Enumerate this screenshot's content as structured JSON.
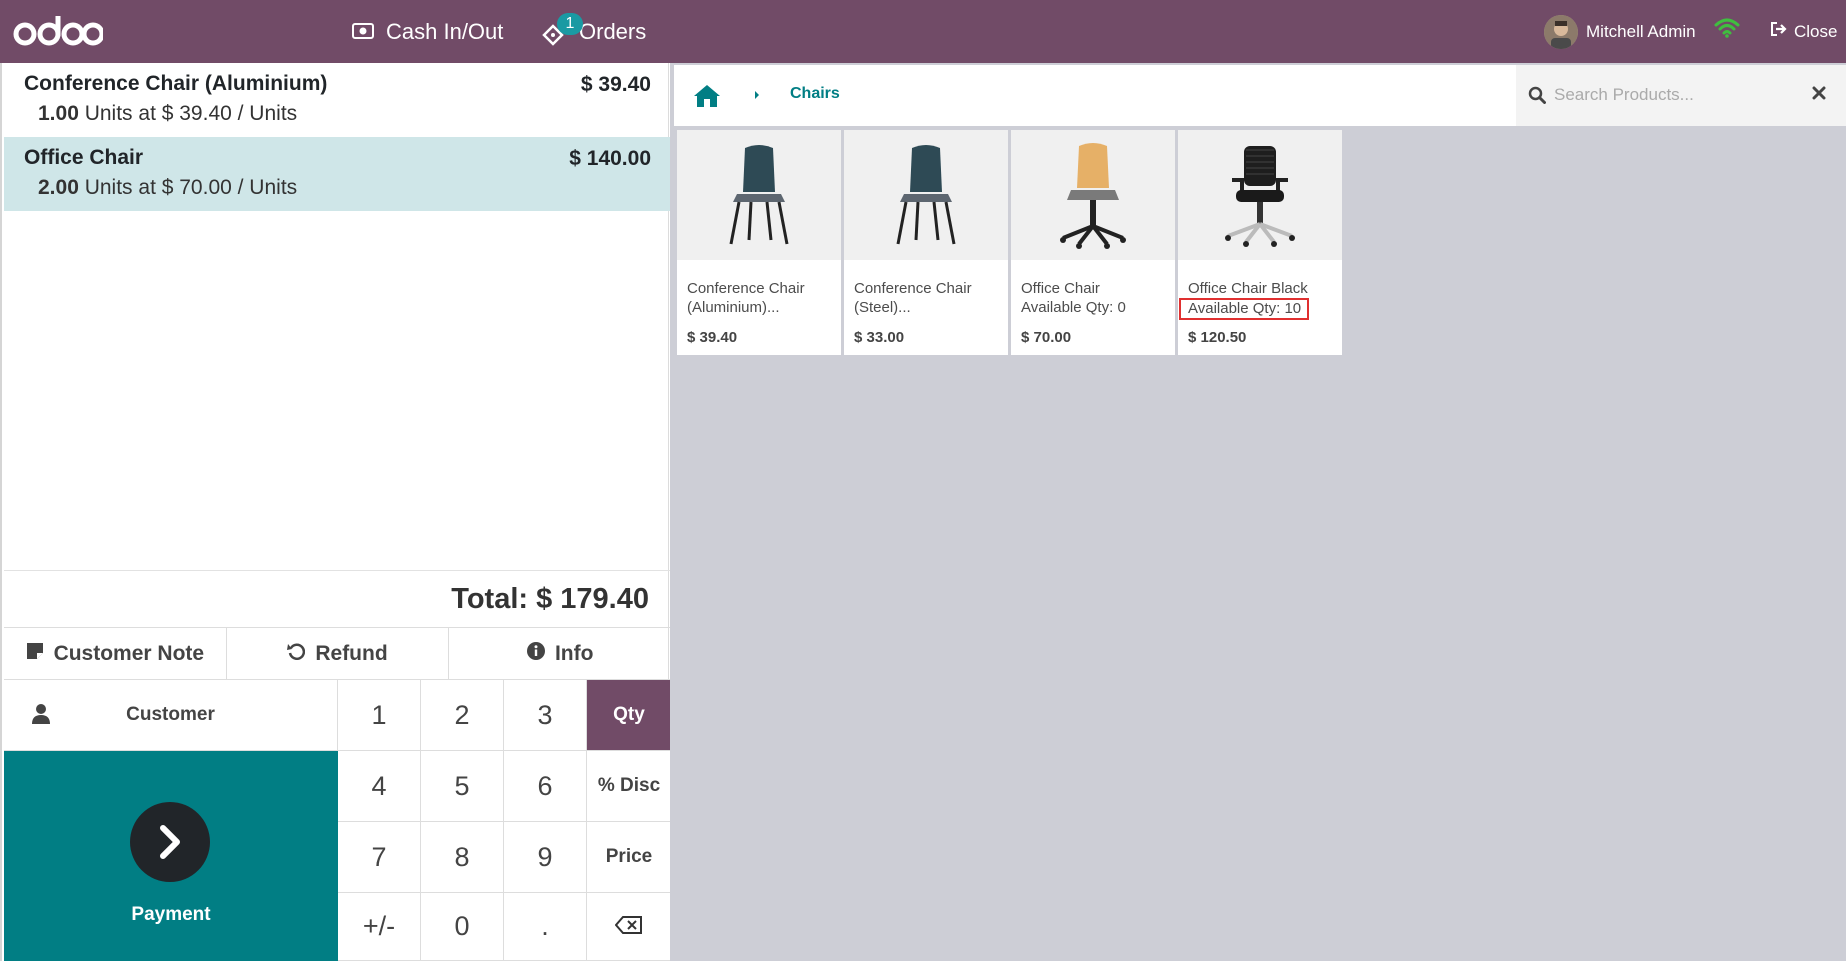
{
  "topbar": {
    "logo_text": "odoo",
    "cash_label": "Cash In/Out",
    "orders_label": "Orders",
    "orders_count": "1",
    "user_name": "Mitchell Admin",
    "close_label": "Close",
    "bg_color": "#714b67"
  },
  "order": {
    "lines": [
      {
        "name": "Conference Chair (Aluminium)",
        "price": "$ 39.40",
        "qty": "1.00",
        "detail": " Units at $ 39.40 / Units",
        "selected": false
      },
      {
        "name": "Office Chair",
        "price": "$ 140.00",
        "qty": "2.00",
        "detail": " Units at $ 70.00 / Units",
        "selected": true
      }
    ],
    "total": "Total: $ 179.40"
  },
  "actions": {
    "customer_note": "Customer Note",
    "refund": "Refund",
    "info": "Info"
  },
  "numpad": {
    "customer": "Customer",
    "payment": "Payment",
    "keys": [
      "1",
      "2",
      "3",
      "Qty",
      "4",
      "5",
      "6",
      "% Disc",
      "7",
      "8",
      "9",
      "Price",
      "+/-",
      "0",
      ".",
      "backspace"
    ],
    "active_mode": "Qty",
    "payment_color": "#017e84"
  },
  "products_panel": {
    "breadcrumb": "Chairs",
    "search_placeholder": "Search Products...",
    "products": [
      {
        "line1": "Conference Chair",
        "line2": "(Aluminium)...",
        "price": "$ 39.40",
        "image": "chair-dark-teal"
      },
      {
        "line1": "Conference Chair",
        "line2": "(Steel)...",
        "price": "$ 33.00",
        "image": "chair-dark-teal"
      },
      {
        "line1": "Office Chair",
        "line2": "Available Qty: 0",
        "price": "$ 70.00",
        "image": "swivel-chair-wood"
      },
      {
        "line1": "Office Chair Black",
        "line2": "Available Qty: 10",
        "price": "$ 120.50",
        "image": "office-chair-black"
      }
    ]
  }
}
